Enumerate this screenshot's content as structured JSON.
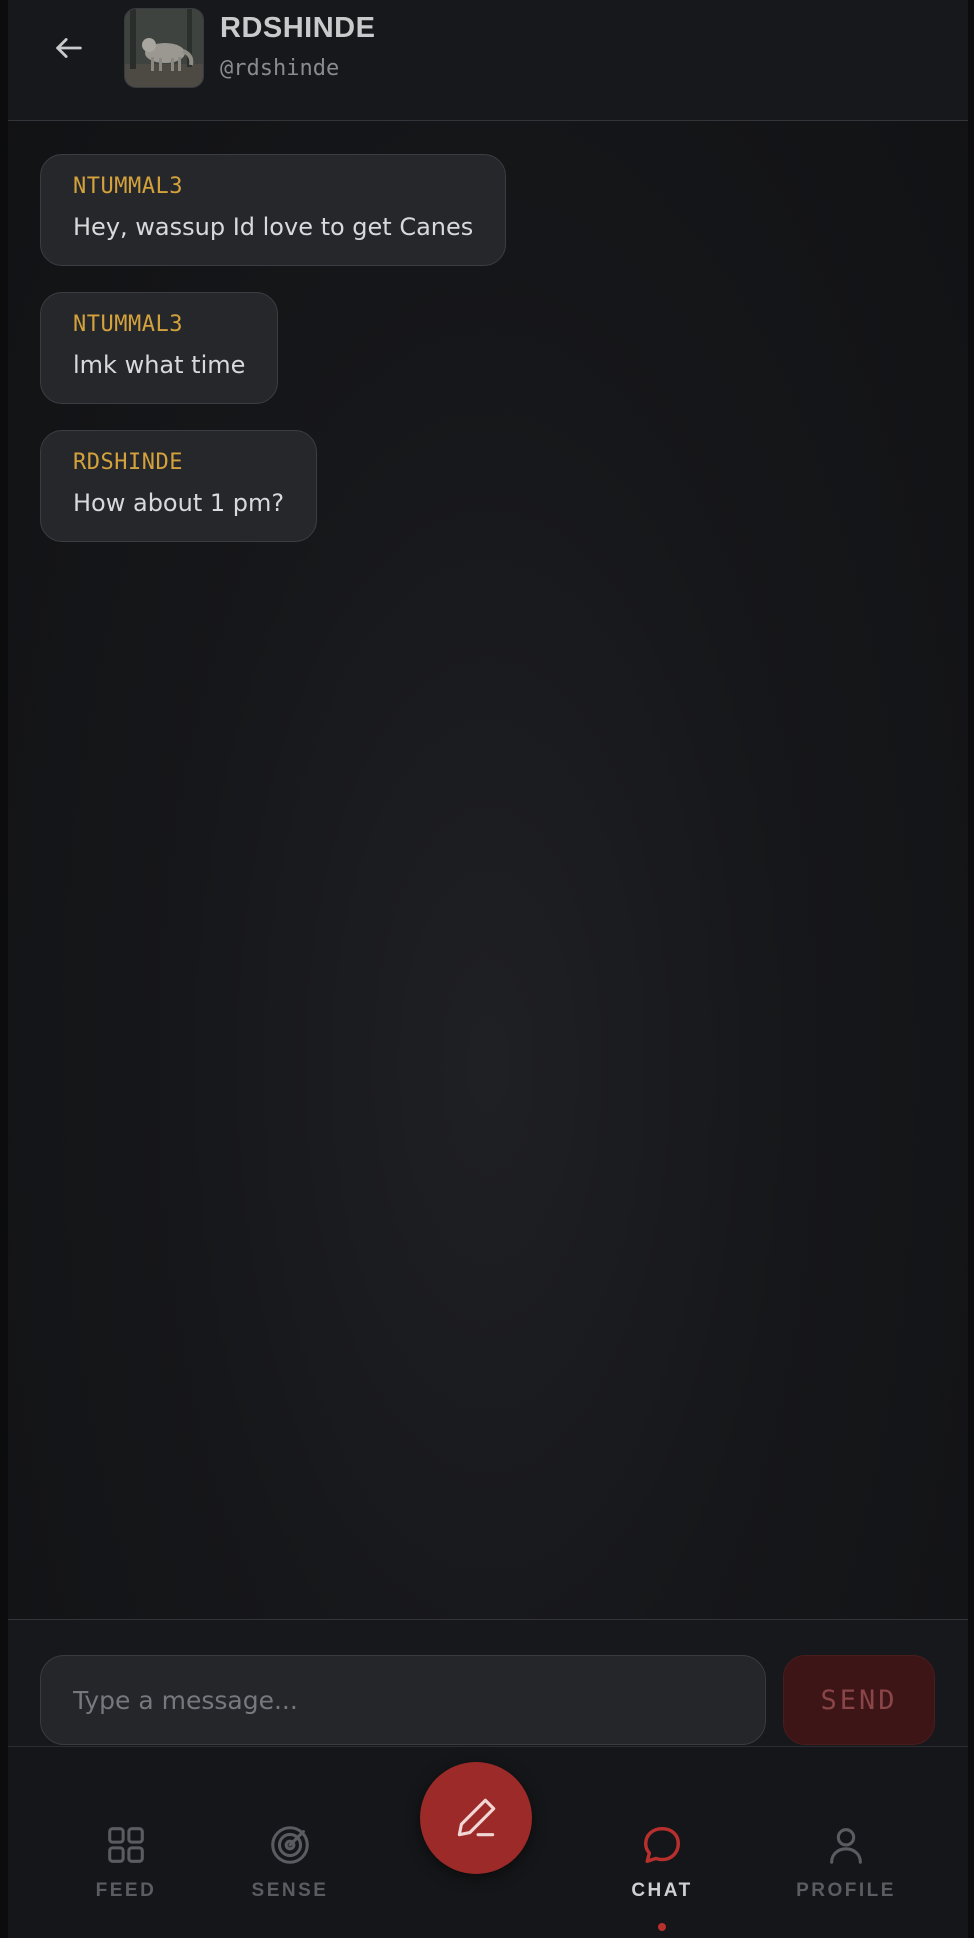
{
  "header": {
    "name": "RDSHINDE",
    "handle": "@rdshinde",
    "back_icon": "arrow-left-icon",
    "avatar": "wolf-photo"
  },
  "messages": [
    {
      "sender": "NTUMMAL3",
      "text": "Hey, wassup Id love to get Canes"
    },
    {
      "sender": "NTUMMAL3",
      "text": "lmk what time"
    },
    {
      "sender": "RDSHINDE",
      "text": "How about 1 pm?"
    }
  ],
  "composer": {
    "placeholder": "Type a message...",
    "value": "",
    "send_label": "SEND"
  },
  "nav": {
    "items": [
      {
        "label": "FEED",
        "icon": "grid-icon"
      },
      {
        "label": "SENSE",
        "icon": "radar-icon"
      },
      {
        "label": "CHAT",
        "icon": "chat-bubble-icon",
        "active": true
      },
      {
        "label": "PROFILE",
        "icon": "user-icon"
      }
    ],
    "fab_icon": "pencil-icon"
  },
  "colors": {
    "accent": "#9b2a28",
    "sender": "#d4a23c",
    "background": "#16171a"
  }
}
